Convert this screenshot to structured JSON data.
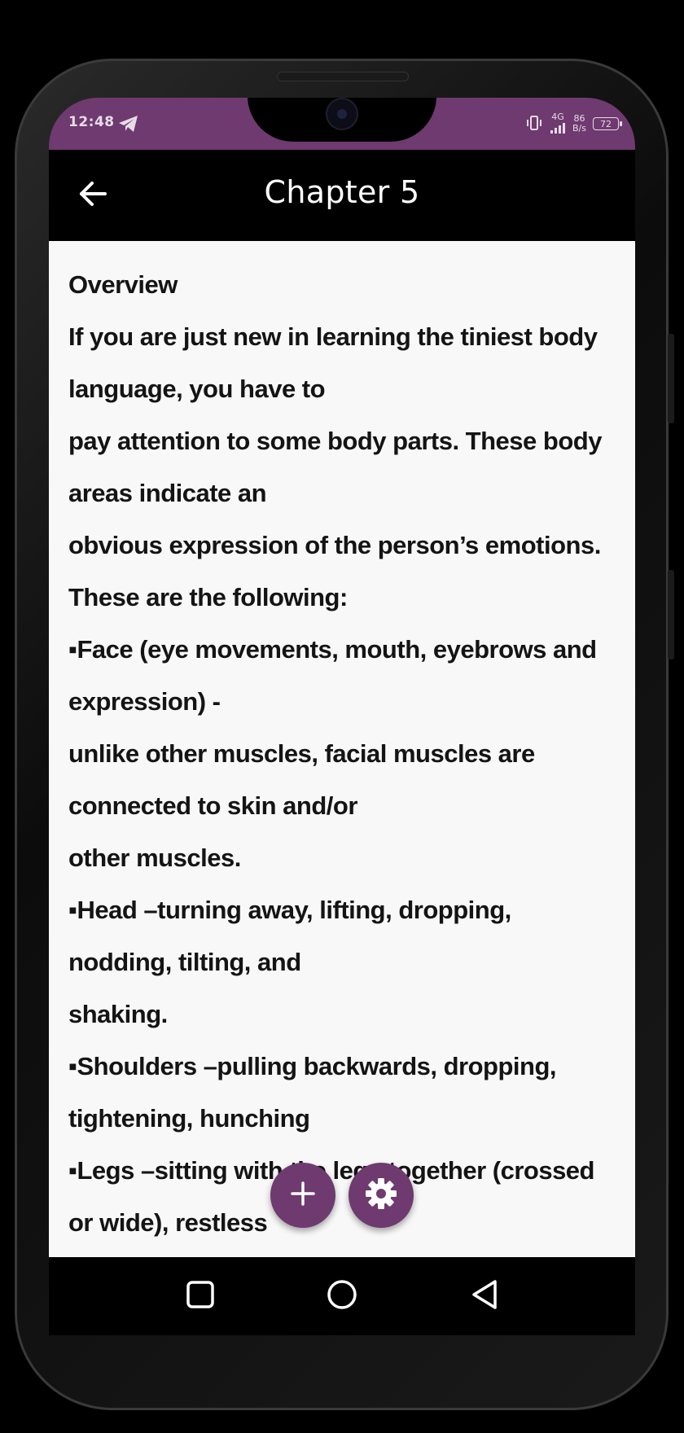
{
  "status_bar": {
    "time": "12:48",
    "network_type": "4G",
    "data_speed_value": "86",
    "data_speed_unit": "B/s",
    "battery": "72",
    "background_color": "#6e3a6f"
  },
  "app_bar": {
    "title": "Chapter 5",
    "back_icon": "arrow-left-icon"
  },
  "content": {
    "lines": [
      "Overview",
      "If you are just new in learning the tiniest body",
      "language, you have to",
      "pay attention to some body parts. These body",
      "areas indicate an",
      "obvious expression of the person’s emotions.",
      "These are the following:",
      "▪Face (eye movements, mouth, eyebrows and",
      "expression) -",
      "unlike other muscles, facial muscles are",
      "connected to skin and/or",
      "other muscles.",
      "▪Head –turning away, lifting, dropping,",
      "nodding, tilting, and",
      "shaking.",
      "▪Shoulders –pulling backwards, dropping,",
      "tightening, hunching",
      "▪Legs –sitting with the legs together (crossed",
      "or wide), restless"
    ]
  },
  "fabs": {
    "add_icon": "plus-icon",
    "settings_icon": "gear-icon",
    "color": "#6e3a6f"
  },
  "nav_bar": {
    "recents_icon": "square-icon",
    "home_icon": "circle-icon",
    "back_icon": "triangle-back-icon"
  }
}
